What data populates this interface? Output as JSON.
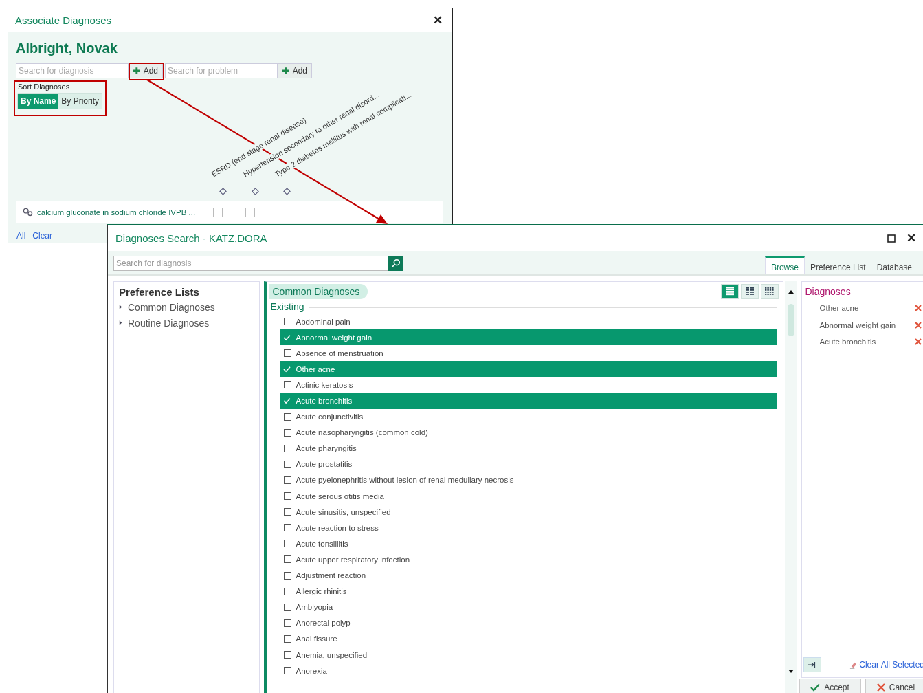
{
  "associate_dialog": {
    "title": "Associate Diagnoses",
    "close_glyph": "✕",
    "patient_name": "Albright, Novak",
    "searches": [
      {
        "placeholder": "Search for diagnosis",
        "add_label": "Add"
      },
      {
        "placeholder": "Search for problem",
        "add_label": "Add"
      }
    ],
    "sort": {
      "label": "Sort Diagnoses",
      "options": [
        {
          "label": "By Name",
          "selected": true
        },
        {
          "label": "By Priority",
          "selected": false
        }
      ]
    },
    "columns": [
      "ESRD (end stage renal disease)",
      "Hypertension secondary to other renal disord...",
      "Type 2 diabetes mellitus with renal complicati..."
    ],
    "orders": [
      {
        "name": "calcium gluconate in sodium chloride IVPB ...",
        "checks": [
          false,
          false,
          false
        ]
      }
    ],
    "links": [
      "All",
      "Clear"
    ]
  },
  "search_dialog": {
    "title": "Diagnoses Search - KATZ,DORA",
    "close_glyph": "✕",
    "search": {
      "placeholder": "Search for diagnosis"
    },
    "tabs": [
      {
        "label": "Browse",
        "selected": true
      },
      {
        "label": "Preference List",
        "selected": false
      },
      {
        "label": "Database",
        "selected": false
      }
    ],
    "preference_lists": {
      "title": "Preference Lists",
      "items": [
        {
          "label": "Common Diagnoses"
        },
        {
          "label": "Routine Diagnoses"
        }
      ]
    },
    "group": {
      "title": "Common Diagnoses",
      "section": "Existing",
      "view_modes": [
        {
          "kind": "list",
          "selected": true
        },
        {
          "kind": "columns",
          "selected": false
        },
        {
          "kind": "grid",
          "selected": false
        }
      ]
    },
    "items": [
      {
        "label": "Abdominal pain",
        "checked": false
      },
      {
        "label": "Abnormal weight gain",
        "checked": true
      },
      {
        "label": "Absence of menstruation",
        "checked": false
      },
      {
        "label": "Other acne",
        "checked": true
      },
      {
        "label": "Actinic keratosis",
        "checked": false
      },
      {
        "label": "Acute bronchitis",
        "checked": true
      },
      {
        "label": "Acute conjunctivitis",
        "checked": false
      },
      {
        "label": "Acute nasopharyngitis (common cold)",
        "checked": false
      },
      {
        "label": "Acute pharyngitis",
        "checked": false
      },
      {
        "label": "Acute prostatitis",
        "checked": false
      },
      {
        "label": "Acute pyelonephritis without lesion of renal medullary necrosis",
        "checked": false
      },
      {
        "label": "Acute serous otitis media",
        "checked": false
      },
      {
        "label": "Acute sinusitis, unspecified",
        "checked": false
      },
      {
        "label": "Acute reaction to stress",
        "checked": false
      },
      {
        "label": "Acute tonsillitis",
        "checked": false
      },
      {
        "label": "Acute upper respiratory infection",
        "checked": false
      },
      {
        "label": "Adjustment reaction",
        "checked": false
      },
      {
        "label": "Allergic rhinitis",
        "checked": false
      },
      {
        "label": "Amblyopia",
        "checked": false
      },
      {
        "label": "Anorectal polyp",
        "checked": false
      },
      {
        "label": "Anal fissure",
        "checked": false
      },
      {
        "label": "Anemia, unspecified",
        "checked": false
      },
      {
        "label": "Anorexia",
        "checked": false
      }
    ],
    "selected_panel": {
      "title": "Diagnoses",
      "items": [
        "Other acne",
        "Abnormal weight gain",
        "Acute bronchitis"
      ]
    },
    "clear_all": "Clear All Selected",
    "buttons": [
      {
        "label": "Accept",
        "kind": "accept"
      },
      {
        "label": "Cancel",
        "kind": "cancel"
      }
    ]
  }
}
